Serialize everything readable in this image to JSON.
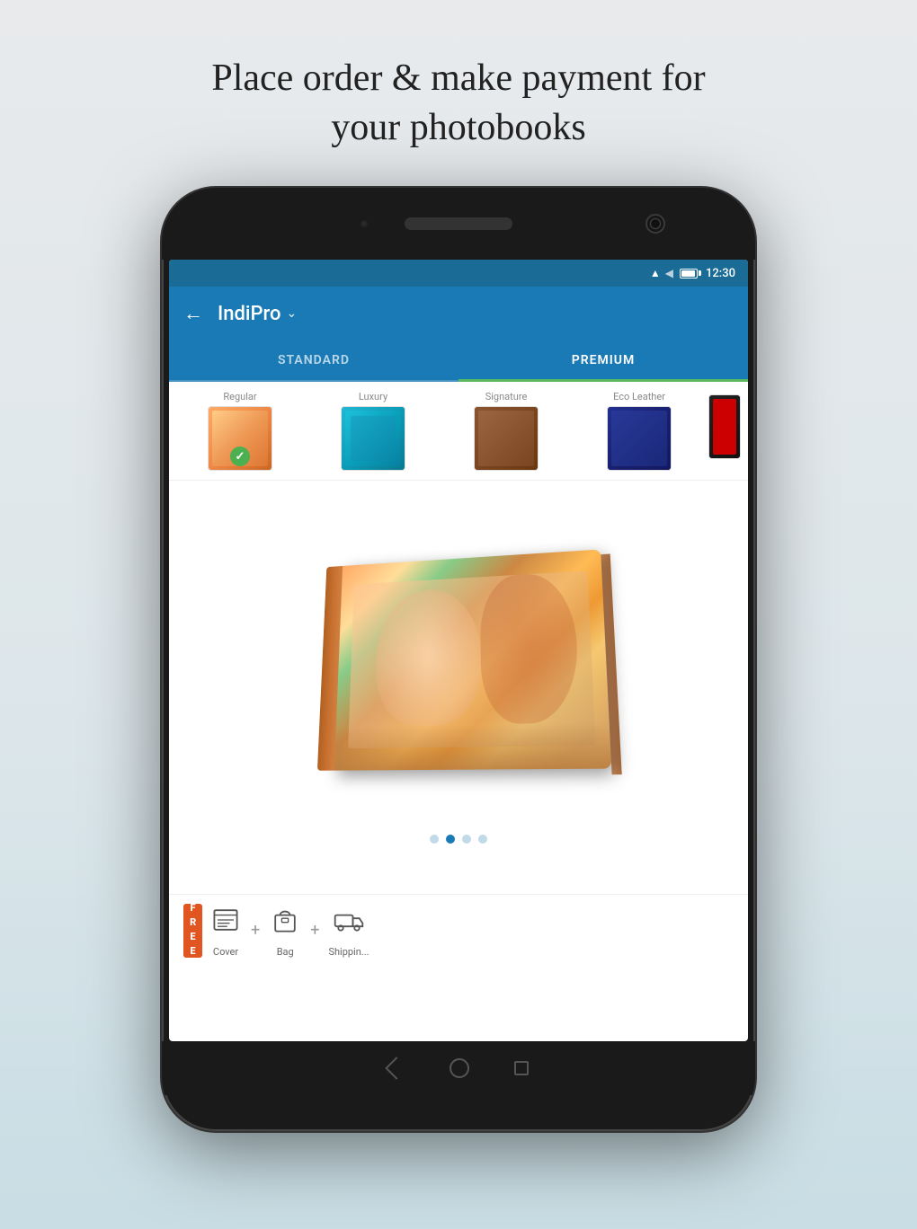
{
  "page": {
    "headline_line1": "Place order & make payment for",
    "headline_line2": "your photobooks"
  },
  "status_bar": {
    "time": "12:30"
  },
  "app_bar": {
    "back_label": "←",
    "title": "IndiPro",
    "dropdown_arrow": "⌄"
  },
  "tabs": [
    {
      "id": "standard",
      "label": "STANDARD",
      "active": false
    },
    {
      "id": "premium",
      "label": "PREMIUM",
      "active": true
    }
  ],
  "cover_types": [
    {
      "id": "regular",
      "label": "Regular",
      "selected": true
    },
    {
      "id": "luxury",
      "label": "Luxury",
      "selected": false
    },
    {
      "id": "signature",
      "label": "Signature",
      "selected": false
    },
    {
      "id": "eco_leather",
      "label": "Eco Leather",
      "selected": false
    }
  ],
  "pagination": {
    "total": 4,
    "active_index": 1
  },
  "free_items": [
    {
      "id": "cover",
      "label": "Cover"
    },
    {
      "id": "bag",
      "label": "Bag"
    },
    {
      "id": "shipping",
      "label": "Shippin..."
    }
  ],
  "free_badge": {
    "text": "FREE"
  }
}
